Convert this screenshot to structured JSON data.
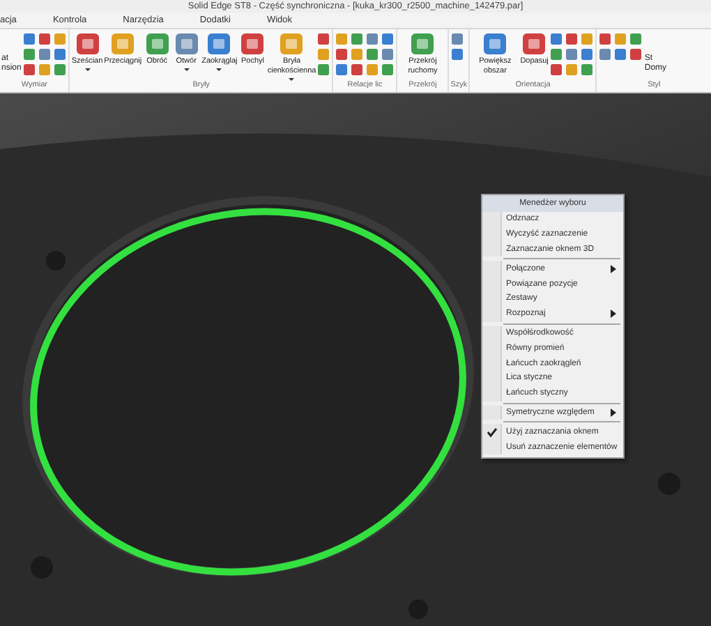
{
  "window": {
    "title": "Solid Edge ST8 - Część synchroniczna - [kuka_kr300_r2500_machine_142479.par]"
  },
  "tabs": [
    {
      "label": "acja",
      "selected": false
    },
    {
      "label": "Kontrola",
      "selected": false
    },
    {
      "label": "Narzędzia",
      "selected": false
    },
    {
      "label": "Dodatki",
      "selected": false
    },
    {
      "label": "Widok",
      "selected": false
    }
  ],
  "ribbon": [
    {
      "label": "Wymiar",
      "cut_labels": [
        "at",
        "nsion"
      ]
    },
    {
      "label": "Bryły",
      "buttons": [
        {
          "label": "Sześcian",
          "dropdown": true
        },
        {
          "label": "Przeciągnij",
          "dropdown": false
        },
        {
          "label": "Obróć",
          "dropdown": false
        },
        {
          "label": "Otwór",
          "dropdown": true
        },
        {
          "label": "Zaokrąglaj",
          "dropdown": true
        },
        {
          "label": "Pochyl",
          "dropdown": false
        },
        {
          "label": "Bryła cienkościenna",
          "dropdown": true
        }
      ]
    },
    {
      "label": "Relacje lic"
    },
    {
      "label": "Przekrój",
      "buttons": [
        {
          "label": "Przekrój ruchomy",
          "dropdown": false
        }
      ]
    },
    {
      "label": "Szyk"
    },
    {
      "label": "Orientacja",
      "buttons": [
        {
          "label": "Powiększ obszar",
          "dropdown": false
        },
        {
          "label": "Dopasuj",
          "dropdown": false
        }
      ]
    },
    {
      "label": "Styl",
      "cut_labels": [
        "St",
        "Domy"
      ]
    }
  ],
  "context_menu": {
    "title": "Menedżer wyboru",
    "items": [
      {
        "label": "Odznacz",
        "kind": "item",
        "submenu": false,
        "checked": false
      },
      {
        "label": "Wyczyść zaznaczenie",
        "kind": "item",
        "submenu": false,
        "checked": false
      },
      {
        "label": "Zaznaczanie oknem 3D",
        "kind": "item",
        "submenu": false,
        "checked": false
      },
      {
        "kind": "separator"
      },
      {
        "label": "Połączone",
        "kind": "item",
        "submenu": true,
        "checked": false
      },
      {
        "label": "Powiązane pozycje",
        "kind": "item",
        "submenu": false,
        "checked": false
      },
      {
        "label": "Zestawy",
        "kind": "item",
        "submenu": false,
        "checked": false
      },
      {
        "label": "Rozpoznaj",
        "kind": "item",
        "submenu": true,
        "checked": false
      },
      {
        "kind": "separator"
      },
      {
        "label": "Współśrodkowość",
        "kind": "item",
        "submenu": false,
        "checked": false
      },
      {
        "label": "Równy promień",
        "kind": "item",
        "submenu": false,
        "checked": false
      },
      {
        "label": "Łańcuch zaokrągleń",
        "kind": "item",
        "submenu": false,
        "checked": false
      },
      {
        "label": "Lica styczne",
        "kind": "item",
        "submenu": false,
        "checked": false
      },
      {
        "label": "Łańcuch styczny",
        "kind": "item",
        "submenu": false,
        "checked": false
      },
      {
        "kind": "separator"
      },
      {
        "label": "Symetryczne względem",
        "kind": "item",
        "submenu": true,
        "checked": false
      },
      {
        "kind": "separator"
      },
      {
        "label": "Użyj zaznaczania oknem",
        "kind": "item",
        "submenu": false,
        "checked": true
      },
      {
        "label": "Usuń zaznaczenie elementów",
        "kind": "item",
        "submenu": false,
        "checked": false
      }
    ]
  }
}
